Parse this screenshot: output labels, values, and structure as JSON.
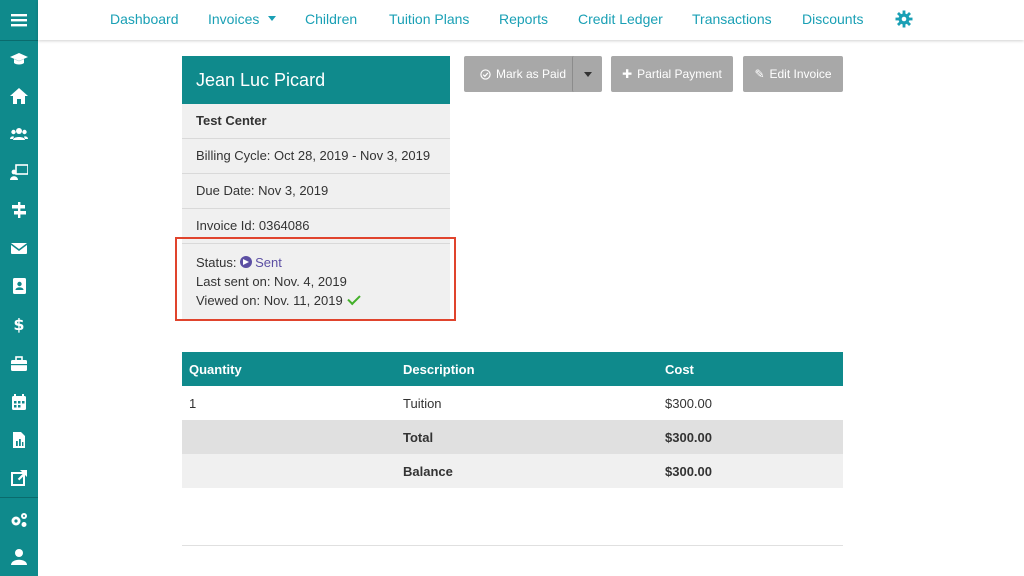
{
  "sidebar": {
    "items": [
      {
        "icon": "menu-icon"
      },
      {
        "icon": "graduation-cap-icon"
      },
      {
        "icon": "home-icon"
      },
      {
        "icon": "users-icon"
      },
      {
        "icon": "chalkboard-teacher-icon"
      },
      {
        "icon": "signpost-icon"
      },
      {
        "icon": "envelope-icon"
      },
      {
        "icon": "address-book-icon"
      },
      {
        "icon": "dollar-icon"
      },
      {
        "icon": "briefcase-icon"
      },
      {
        "icon": "calendar-icon"
      },
      {
        "icon": "file-chart-icon"
      },
      {
        "icon": "external-link-icon"
      },
      {
        "icon": "cogs-icon"
      },
      {
        "icon": "user-icon"
      }
    ],
    "bg_color": "#0f8a8c"
  },
  "nav": {
    "links": [
      "Dashboard",
      "Invoices",
      "Children",
      "Tuition Plans",
      "Reports",
      "Credit Ledger",
      "Transactions",
      "Discounts"
    ],
    "settings_icon": "gear-icon",
    "link_color": "#1aa0b5"
  },
  "invoice": {
    "name": "Jean Luc Picard",
    "center": "Test Center",
    "billing_cycle": "Billing Cycle: Oct 28, 2019 - Nov 3, 2019",
    "due_date": "Due Date: Nov 3, 2019",
    "invoice_id": "Invoice Id: 0364086",
    "status_label": "Status:",
    "status_value": "Sent",
    "last_sent": "Last sent on: Nov. 4, 2019",
    "viewed_on": "Viewed on: Nov. 11, 2019"
  },
  "actions": {
    "mark_paid": "Mark as Paid",
    "partial_payment": "Partial Payment",
    "edit_invoice": "Edit Invoice"
  },
  "table": {
    "headers": [
      "Quantity",
      "Description",
      "Cost"
    ],
    "rows": [
      {
        "quantity": "1",
        "description": "Tuition",
        "cost": "$300.00"
      }
    ],
    "total_label": "Total",
    "total_value": "$300.00",
    "balance_label": "Balance",
    "balance_value": "$300.00"
  },
  "colors": {
    "accent": "#0f8a8c",
    "highlight": "#e0442d",
    "status_sent": "#5c4fa3",
    "check": "#43b02a"
  }
}
